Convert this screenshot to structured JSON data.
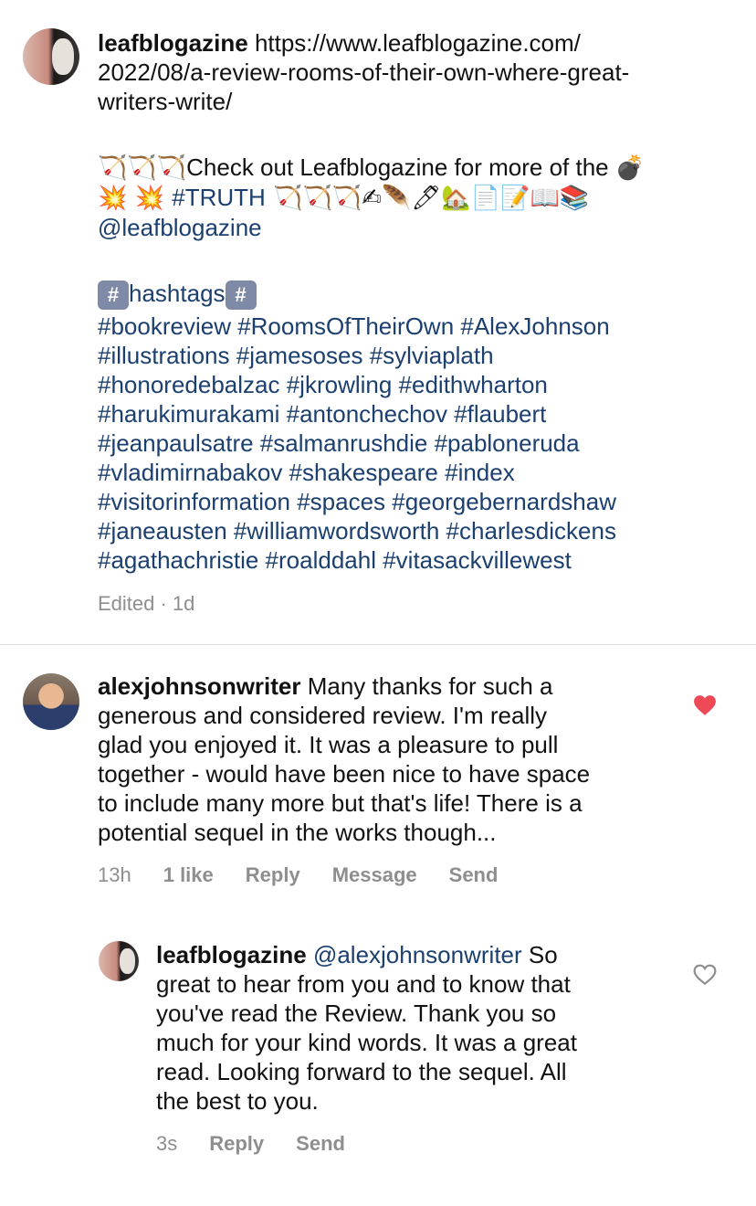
{
  "post": {
    "username": "leafblogazine",
    "url_lines": [
      "https://www.leafblogazine.com/",
      "2022/08/a-review-rooms-of-their-own-where-great-",
      "writers-write/"
    ],
    "emoji_line_1_prefix": "🏹🏹🏹",
    "emoji_line_1_text": "Check out Leafblogazine for more of the ",
    "emoji_line_1_suffix": "💣",
    "emoji_line_2_prefix": "💥 💥 ",
    "emoji_line_2_tag": "#TRUTH",
    "emoji_line_2_suffix": " 🏹🏹🏹✍🪶🖊🏡📄📝📖📚",
    "mention": "@leafblogazine",
    "hashtags_heading": "hashtags",
    "hashtag_box": "#",
    "hashtag_lines": [
      "#bookreview #RoomsOfTheirOwn #AlexJohnson",
      "#illustrations #jamesoses #sylviaplath",
      "#honoredebalzac #jkrowling #edithwharton",
      "#harukimurakami #antonchechov #flaubert",
      "#jeanpaulsatre #salmanrushdie #pabloneruda",
      "#vladimirnabakov #shakespeare #index",
      "#visitorinformation #spaces #georgebernardshaw",
      "#janeausten #williamwordsworth #charlesdickens",
      "#agathachristie #roalddahl #vitasackvillewest"
    ],
    "meta": "Edited · 1d"
  },
  "comment1": {
    "username": "alexjohnsonwriter",
    "lines": [
      " Many thanks for such a",
      "generous and considered review. I'm really",
      "glad you enjoyed it. It was a pleasure to pull",
      "together - would have been nice to have space",
      "to include many more but that's life! There is a",
      "potential sequel in the works though..."
    ],
    "time": "13h",
    "likes": "1 like",
    "reply": "Reply",
    "message": "Message",
    "send": "Send",
    "liked": true,
    "heart_color": "#ed4956"
  },
  "reply1": {
    "username": "leafblogazine",
    "mention": "@alexjohnsonwriter",
    "lines": [
      " So",
      "great to hear from you and to know that",
      "you've read the Review. Thank you so",
      "much for your kind words. It was a great",
      "read. Looking forward to the sequel. All",
      "the best to you."
    ],
    "time": "3s",
    "reply": "Reply",
    "send": "Send",
    "liked": false
  }
}
